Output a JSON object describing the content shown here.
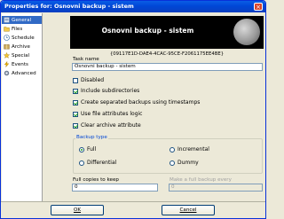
{
  "window": {
    "title": "Properties for: Osnovni backup - sistem",
    "close_glyph": "×"
  },
  "sidebar": {
    "items": [
      {
        "label": "General",
        "icon": "general-icon",
        "selected": true
      },
      {
        "label": "Files",
        "icon": "files-icon"
      },
      {
        "label": "Schedule",
        "icon": "schedule-icon"
      },
      {
        "label": "Archive",
        "icon": "archive-icon"
      },
      {
        "label": "Special",
        "icon": "special-icon"
      },
      {
        "label": "Events",
        "icon": "events-icon"
      },
      {
        "label": "Advanced",
        "icon": "advanced-icon"
      }
    ]
  },
  "banner": {
    "title": "Osnovni backup - sistem"
  },
  "guid": "{09117E1D-DAE4-4CAC-95CE-F2061175EE4BE}",
  "task_name": {
    "label": "Task name",
    "value": "Osnovni backup - sistem"
  },
  "options": [
    {
      "label": "Disabled",
      "checked": false
    },
    {
      "label": "Include subdirectories",
      "checked": true
    },
    {
      "label": "Create separated backups using timestamps",
      "checked": true
    },
    {
      "label": "Use file attributes logic",
      "checked": true
    },
    {
      "label": "Clear archive attribute",
      "checked": true
    }
  ],
  "backup_type": {
    "title": "Backup type",
    "options": [
      {
        "label": "Full",
        "checked": true
      },
      {
        "label": "Incremental",
        "checked": false
      },
      {
        "label": "Differential",
        "checked": false
      },
      {
        "label": "Dummy",
        "checked": false
      }
    ]
  },
  "full_copies": {
    "label": "Full copies to keep",
    "value": "0"
  },
  "make_full": {
    "label": "Make a full backup every",
    "value": "0"
  },
  "buttons": {
    "ok": "OK",
    "cancel": "Cancel"
  },
  "colors": {
    "titlebar": "#0a5ee5",
    "selection": "#316ac5",
    "check": "#21a121",
    "group_title": "#0046d5"
  }
}
